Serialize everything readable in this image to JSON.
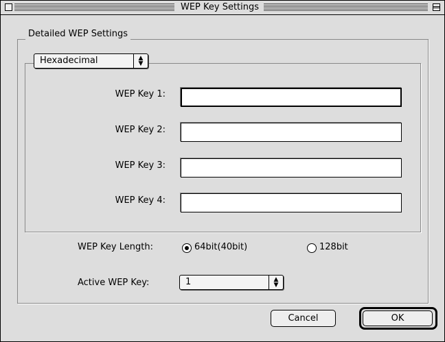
{
  "window": {
    "title": "WEP Key Settings"
  },
  "group": {
    "label": "Detailed WEP Settings"
  },
  "encoding": {
    "selected": "Hexadecimal"
  },
  "keys": [
    {
      "label": "WEP Key 1:",
      "value": ""
    },
    {
      "label": "WEP Key 2:",
      "value": ""
    },
    {
      "label": "WEP Key 3:",
      "value": ""
    },
    {
      "label": "WEP Key 4:",
      "value": ""
    }
  ],
  "key_length": {
    "label": "WEP Key Length:",
    "options": [
      {
        "label": "64bit(40bit)",
        "selected": true
      },
      {
        "label": "128bit",
        "selected": false
      }
    ]
  },
  "active_key": {
    "label": "Active WEP Key:",
    "selected": "1"
  },
  "buttons": {
    "cancel": "Cancel",
    "ok": "OK"
  },
  "icons": {
    "popup_arrows": "up-down-arrows-icon",
    "close_box": "close-box-icon",
    "collapse_box": "collapse-box-icon"
  }
}
